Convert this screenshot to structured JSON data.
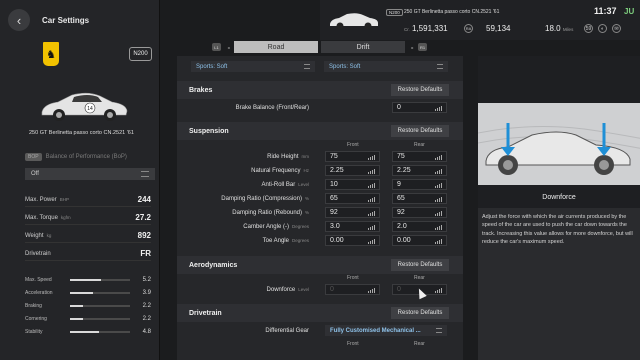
{
  "header": {
    "title": "Car Settings",
    "back_icon": "chevron-left-icon"
  },
  "car": {
    "badge": "N200",
    "name": "250 GT Berlinetta passo corto CN.2521 '61",
    "brand_logo": "ferrari-prancing-horse-logo",
    "race_number": "14"
  },
  "bop": {
    "tag": "BOP",
    "label": "Balance of Performance (BoP)",
    "value": "Off"
  },
  "specs": [
    {
      "label": "Max. Power",
      "unit": "BHP",
      "value": "244"
    },
    {
      "label": "Max. Torque",
      "unit": "kgfm",
      "value": "27.2"
    },
    {
      "label": "Weight",
      "unit": "kg",
      "value": "892"
    },
    {
      "label": "Drivetrain",
      "unit": "",
      "value": "FR"
    }
  ],
  "performance": [
    {
      "label": "Max. Speed",
      "value": "5.2",
      "fraction": 0.52
    },
    {
      "label": "Acceleration",
      "value": "3.9",
      "fraction": 0.39
    },
    {
      "label": "Braking",
      "value": "2.2",
      "fraction": 0.22
    },
    {
      "label": "Cornering",
      "value": "2.2",
      "fraction": 0.22
    },
    {
      "label": "Stability",
      "value": "4.8",
      "fraction": 0.48
    }
  ],
  "topbar": {
    "badge": "N200",
    "car_name": "250 GT Berlinetta passo corto CN.2521 '61",
    "clock": "11:37",
    "clock_suffix": "JU",
    "credits_symbol": "Cr.",
    "credits": "1,591,331",
    "credits_badge": "RA",
    "mileage_points": "59,134",
    "distance": "18.0",
    "distance_unit": "Miles",
    "level": "59"
  },
  "tabs": {
    "left_key": "L1",
    "road": "Road",
    "drift": "Drift",
    "right_key": "R1"
  },
  "tyres": {
    "front": "Sports: Soft",
    "rear": "Sports: Soft"
  },
  "restore_label": "Restore Defaults",
  "col_front": "Front",
  "col_rear": "Rear",
  "brakes": {
    "title": "Brakes",
    "rows": [
      {
        "label": "Brake Balance (Front/Rear)",
        "unit": "",
        "value": "0"
      }
    ]
  },
  "suspension": {
    "title": "Suspension",
    "rows": [
      {
        "label": "Ride Height",
        "unit": "mm",
        "front": "75",
        "rear": "75"
      },
      {
        "label": "Natural Frequency",
        "unit": "Hz",
        "front": "2.25",
        "rear": "2.25"
      },
      {
        "label": "Anti-Roll Bar",
        "unit": "Level",
        "front": "10",
        "rear": "9"
      },
      {
        "label": "Damping Ratio (Compression)",
        "unit": "%",
        "front": "65",
        "rear": "65"
      },
      {
        "label": "Damping Ratio (Rebound)",
        "unit": "%",
        "front": "92",
        "rear": "92"
      },
      {
        "label": "Camber Angle (-)",
        "unit": "Degrees",
        "front": "3.0",
        "rear": "2.0"
      },
      {
        "label": "Toe Angle",
        "unit": "Degrees",
        "front": "0.00",
        "rear": "0.00"
      }
    ]
  },
  "aero": {
    "title": "Aerodynamics",
    "rows": [
      {
        "label": "Downforce",
        "unit": "Level",
        "front": "0",
        "rear": "0"
      }
    ]
  },
  "drivetrain": {
    "title": "Drivetrain",
    "differential_label": "Differential Gear",
    "differential_value": "Fully Customised Mechanical ..."
  },
  "info": {
    "title": "Downforce",
    "text": "Adjust the force with which the air currents produced by the speed of the car are used to push the car down towards the track. Increasing this value allows for more downforce, but will reduce the car's maximum speed."
  },
  "colors": {
    "accent_blue": "#1f8fd6",
    "value_blue": "#8ec1e8",
    "logo_yellow": "#f2c200",
    "clock_green": "#7fd07f"
  }
}
